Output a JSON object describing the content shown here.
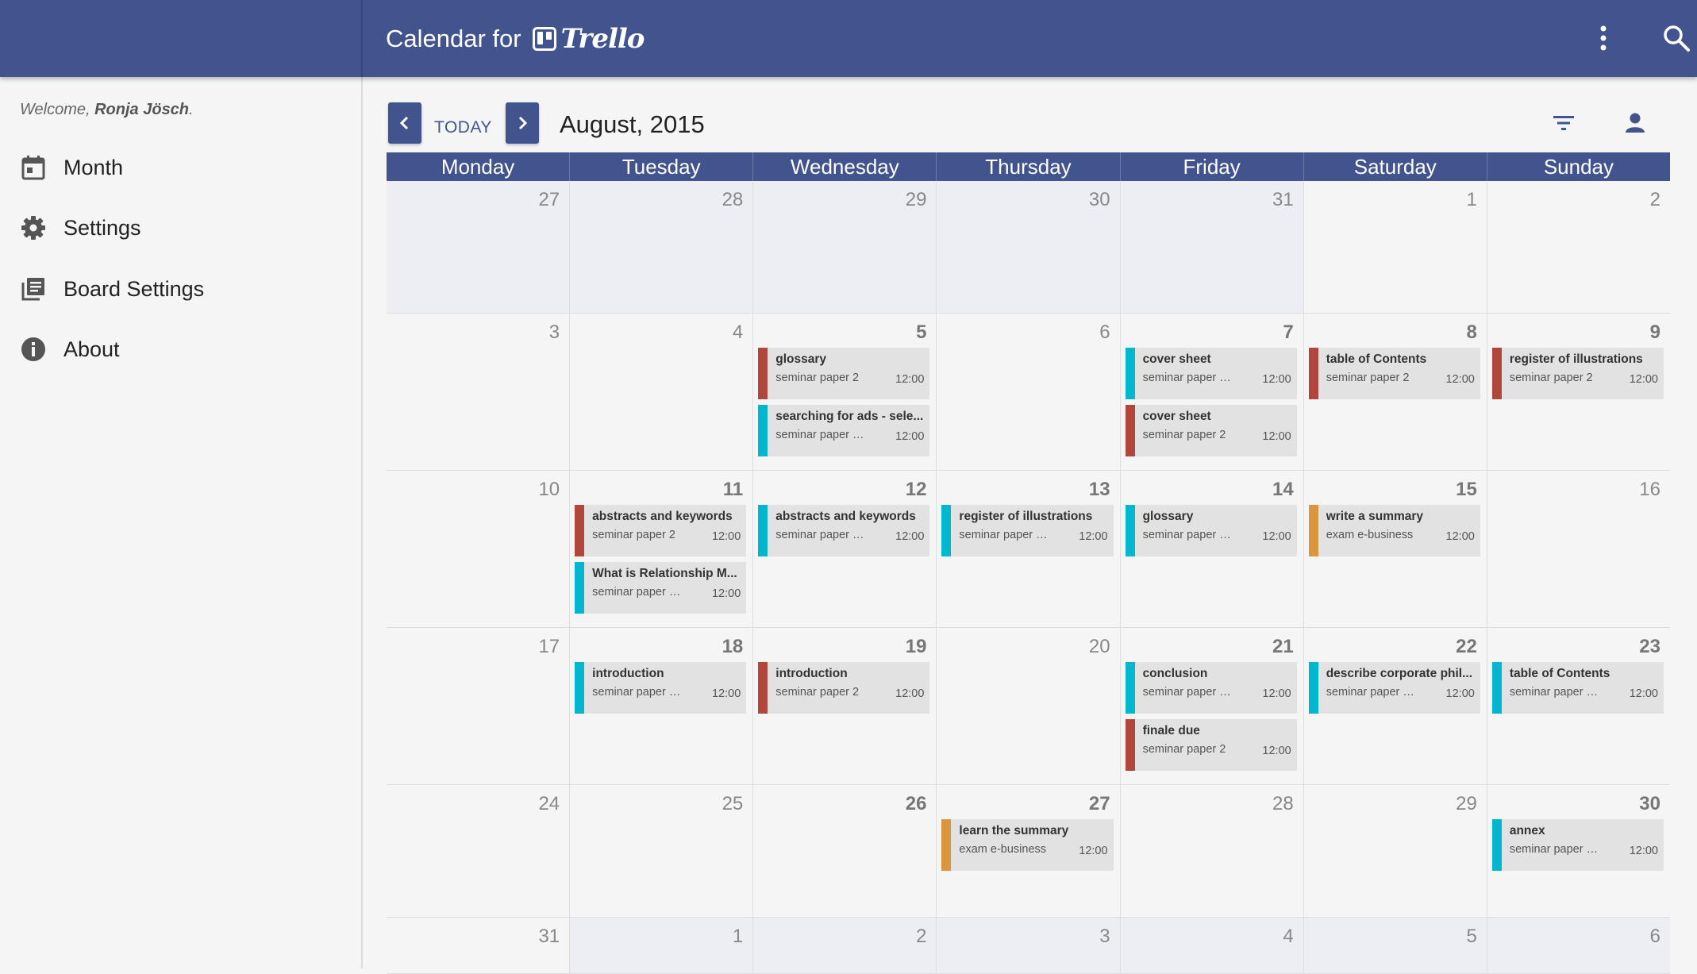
{
  "app": {
    "title_prefix": "Calendar for",
    "logo_word": "Trello"
  },
  "sidebar": {
    "welcome_prefix": "Welcome,",
    "user_name": "Ronja Jösch",
    "items": [
      {
        "label": "Month",
        "icon": "calendar-icon"
      },
      {
        "label": "Settings",
        "icon": "gear-icon"
      },
      {
        "label": "Board Settings",
        "icon": "board-list-icon"
      },
      {
        "label": "About",
        "icon": "info-icon"
      }
    ]
  },
  "toolbar": {
    "today_label": "TODAY",
    "month_title": "August, 2015"
  },
  "colors": {
    "primary": "#41548e",
    "red": "#b0463c",
    "cyan": "#00b7cf",
    "orange": "#d8973c"
  },
  "calendar": {
    "weekdays": [
      "Monday",
      "Tuesday",
      "Wednesday",
      "Thursday",
      "Friday",
      "Saturday",
      "Sunday"
    ],
    "weeks": [
      [
        {
          "day": "27",
          "other": true
        },
        {
          "day": "28",
          "other": true
        },
        {
          "day": "29",
          "other": true
        },
        {
          "day": "30",
          "other": true
        },
        {
          "day": "31",
          "other": true
        },
        {
          "day": "1"
        },
        {
          "day": "2"
        }
      ],
      [
        {
          "day": "3"
        },
        {
          "day": "4"
        },
        {
          "day": "5",
          "events": [
            {
              "title": "glossary",
              "board": "seminar paper 2",
              "time": "12:00",
              "color": "red"
            },
            {
              "title": "searching for ads - sele...",
              "board": "seminar paper - ...",
              "time": "12:00",
              "color": "cyan"
            }
          ]
        },
        {
          "day": "6"
        },
        {
          "day": "7",
          "events": [
            {
              "title": "cover sheet",
              "board": "seminar paper - ...",
              "time": "12:00",
              "color": "cyan"
            },
            {
              "title": "cover sheet",
              "board": "seminar paper 2",
              "time": "12:00",
              "color": "red"
            }
          ]
        },
        {
          "day": "8",
          "events": [
            {
              "title": "table of Contents",
              "board": "seminar paper 2",
              "time": "12:00",
              "color": "red"
            }
          ]
        },
        {
          "day": "9",
          "events": [
            {
              "title": "register of illustrations",
              "board": "seminar paper 2",
              "time": "12:00",
              "color": "red"
            }
          ]
        }
      ],
      [
        {
          "day": "10"
        },
        {
          "day": "11",
          "events": [
            {
              "title": "abstracts and keywords",
              "board": "seminar paper 2",
              "time": "12:00",
              "color": "red"
            },
            {
              "title": "What is Relationship M...",
              "board": "seminar paper - ...",
              "time": "12:00",
              "color": "cyan"
            }
          ]
        },
        {
          "day": "12",
          "events": [
            {
              "title": "abstracts and keywords",
              "board": "seminar paper - ...",
              "time": "12:00",
              "color": "cyan"
            }
          ]
        },
        {
          "day": "13",
          "events": [
            {
              "title": "register of illustrations",
              "board": "seminar paper - ...",
              "time": "12:00",
              "color": "cyan"
            }
          ]
        },
        {
          "day": "14",
          "events": [
            {
              "title": "glossary",
              "board": "seminar paper - ...",
              "time": "12:00",
              "color": "cyan"
            }
          ]
        },
        {
          "day": "15",
          "events": [
            {
              "title": "write a summary",
              "board": "exam e-business",
              "time": "12:00",
              "color": "orange"
            }
          ]
        },
        {
          "day": "16"
        }
      ],
      [
        {
          "day": "17"
        },
        {
          "day": "18",
          "events": [
            {
              "title": "introduction",
              "board": "seminar paper - ...",
              "time": "12:00",
              "color": "cyan"
            }
          ]
        },
        {
          "day": "19",
          "events": [
            {
              "title": "introduction",
              "board": "seminar paper 2",
              "time": "12:00",
              "color": "red"
            }
          ]
        },
        {
          "day": "20"
        },
        {
          "day": "21",
          "events": [
            {
              "title": "conclusion",
              "board": "seminar paper - ...",
              "time": "12:00",
              "color": "cyan"
            },
            {
              "title": "finale due",
              "board": "seminar paper 2",
              "time": "12:00",
              "color": "red"
            }
          ]
        },
        {
          "day": "22",
          "events": [
            {
              "title": "describe corporate phil...",
              "board": "seminar paper - ...",
              "time": "12:00",
              "color": "cyan"
            }
          ]
        },
        {
          "day": "23",
          "events": [
            {
              "title": "table of Contents",
              "board": "seminar paper - ...",
              "time": "12:00",
              "color": "cyan"
            }
          ]
        }
      ],
      [
        {
          "day": "24"
        },
        {
          "day": "25"
        },
        {
          "day": "26",
          "bold": true
        },
        {
          "day": "27",
          "events": [
            {
              "title": "learn the summary",
              "board": "exam e-business",
              "time": "12:00",
              "color": "orange"
            }
          ]
        },
        {
          "day": "28"
        },
        {
          "day": "29"
        },
        {
          "day": "30",
          "events": [
            {
              "title": "annex",
              "board": "seminar paper - ...",
              "time": "12:00",
              "color": "cyan"
            }
          ]
        }
      ],
      [
        {
          "day": "31"
        },
        {
          "day": "1",
          "other": true
        },
        {
          "day": "2",
          "other": true
        },
        {
          "day": "3",
          "other": true
        },
        {
          "day": "4",
          "other": true
        },
        {
          "day": "5",
          "other": true
        },
        {
          "day": "6",
          "other": true
        }
      ]
    ]
  }
}
